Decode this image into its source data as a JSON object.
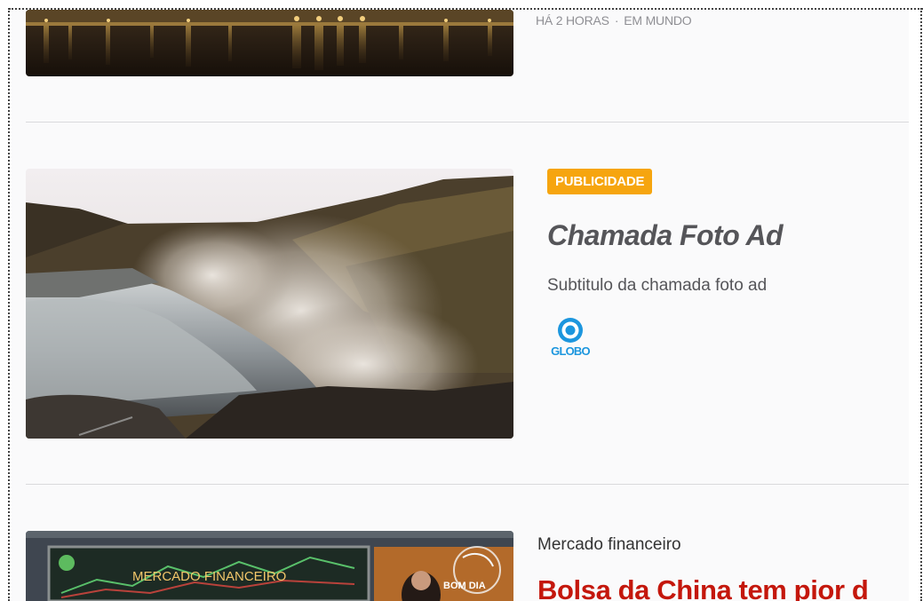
{
  "articles": [
    {
      "time": "HÁ 2 HORAS",
      "separator": "·",
      "section": "EM MUNDO"
    },
    {
      "badge": "PUBLICIDADE",
      "title": "Chamada Foto Ad",
      "subtitle": "Subtitulo da chamada foto ad",
      "brand": "GLOBO"
    },
    {
      "kicker": "Mercado financeiro",
      "headline": "Bolsa da China tem pior d",
      "image_texts": {
        "screen_label": "MERCADO FINANCEIRO",
        "show_logo": "BOM DIA"
      }
    }
  ],
  "colors": {
    "badge": "#f6a50f",
    "headline": "#c4170c",
    "globo_blue": "#1c96de"
  }
}
